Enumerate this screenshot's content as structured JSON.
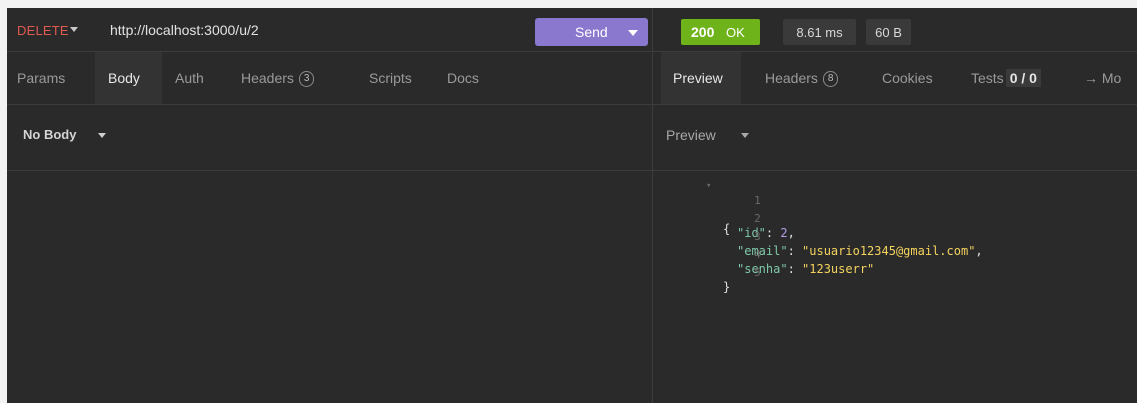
{
  "request": {
    "method": "DELETE",
    "url": "http://localhost:3000/u/2",
    "send_label": "Send",
    "tabs": [
      {
        "label": "Params"
      },
      {
        "label": "Body"
      },
      {
        "label": "Auth"
      },
      {
        "label": "Headers",
        "count": "3"
      },
      {
        "label": "Scripts"
      },
      {
        "label": "Docs"
      }
    ],
    "body_type": "No Body"
  },
  "response": {
    "status_code": "200",
    "status_text": "OK",
    "time": "8.61 ms",
    "size": "60 B",
    "tabs": [
      {
        "label": "Preview"
      },
      {
        "label": "Headers",
        "count": "8"
      },
      {
        "label": "Cookies"
      },
      {
        "label": "Tests",
        "count": "0 / 0"
      },
      {
        "label": "→ Mo"
      }
    ],
    "preview_mode": "Preview",
    "body_lines": [
      {
        "n": "1",
        "open": "{"
      },
      {
        "n": "2",
        "key": "\"id\"",
        "value": "2",
        "trail": ","
      },
      {
        "n": "3",
        "key": "\"email\"",
        "value": "\"usuario12345@gmail.com\"",
        "trail": ","
      },
      {
        "n": "4",
        "key": "\"senha\"",
        "value": "\"123userr\"",
        "trail": ""
      },
      {
        "n": "5",
        "close": "}"
      }
    ]
  },
  "colors": {
    "method": "#e05a52",
    "send": "#8a78cf",
    "status_ok": "#6fb31b",
    "json_key": "#7ec8a8",
    "json_string": "#f4d35e",
    "json_number": "#b59ee8"
  }
}
